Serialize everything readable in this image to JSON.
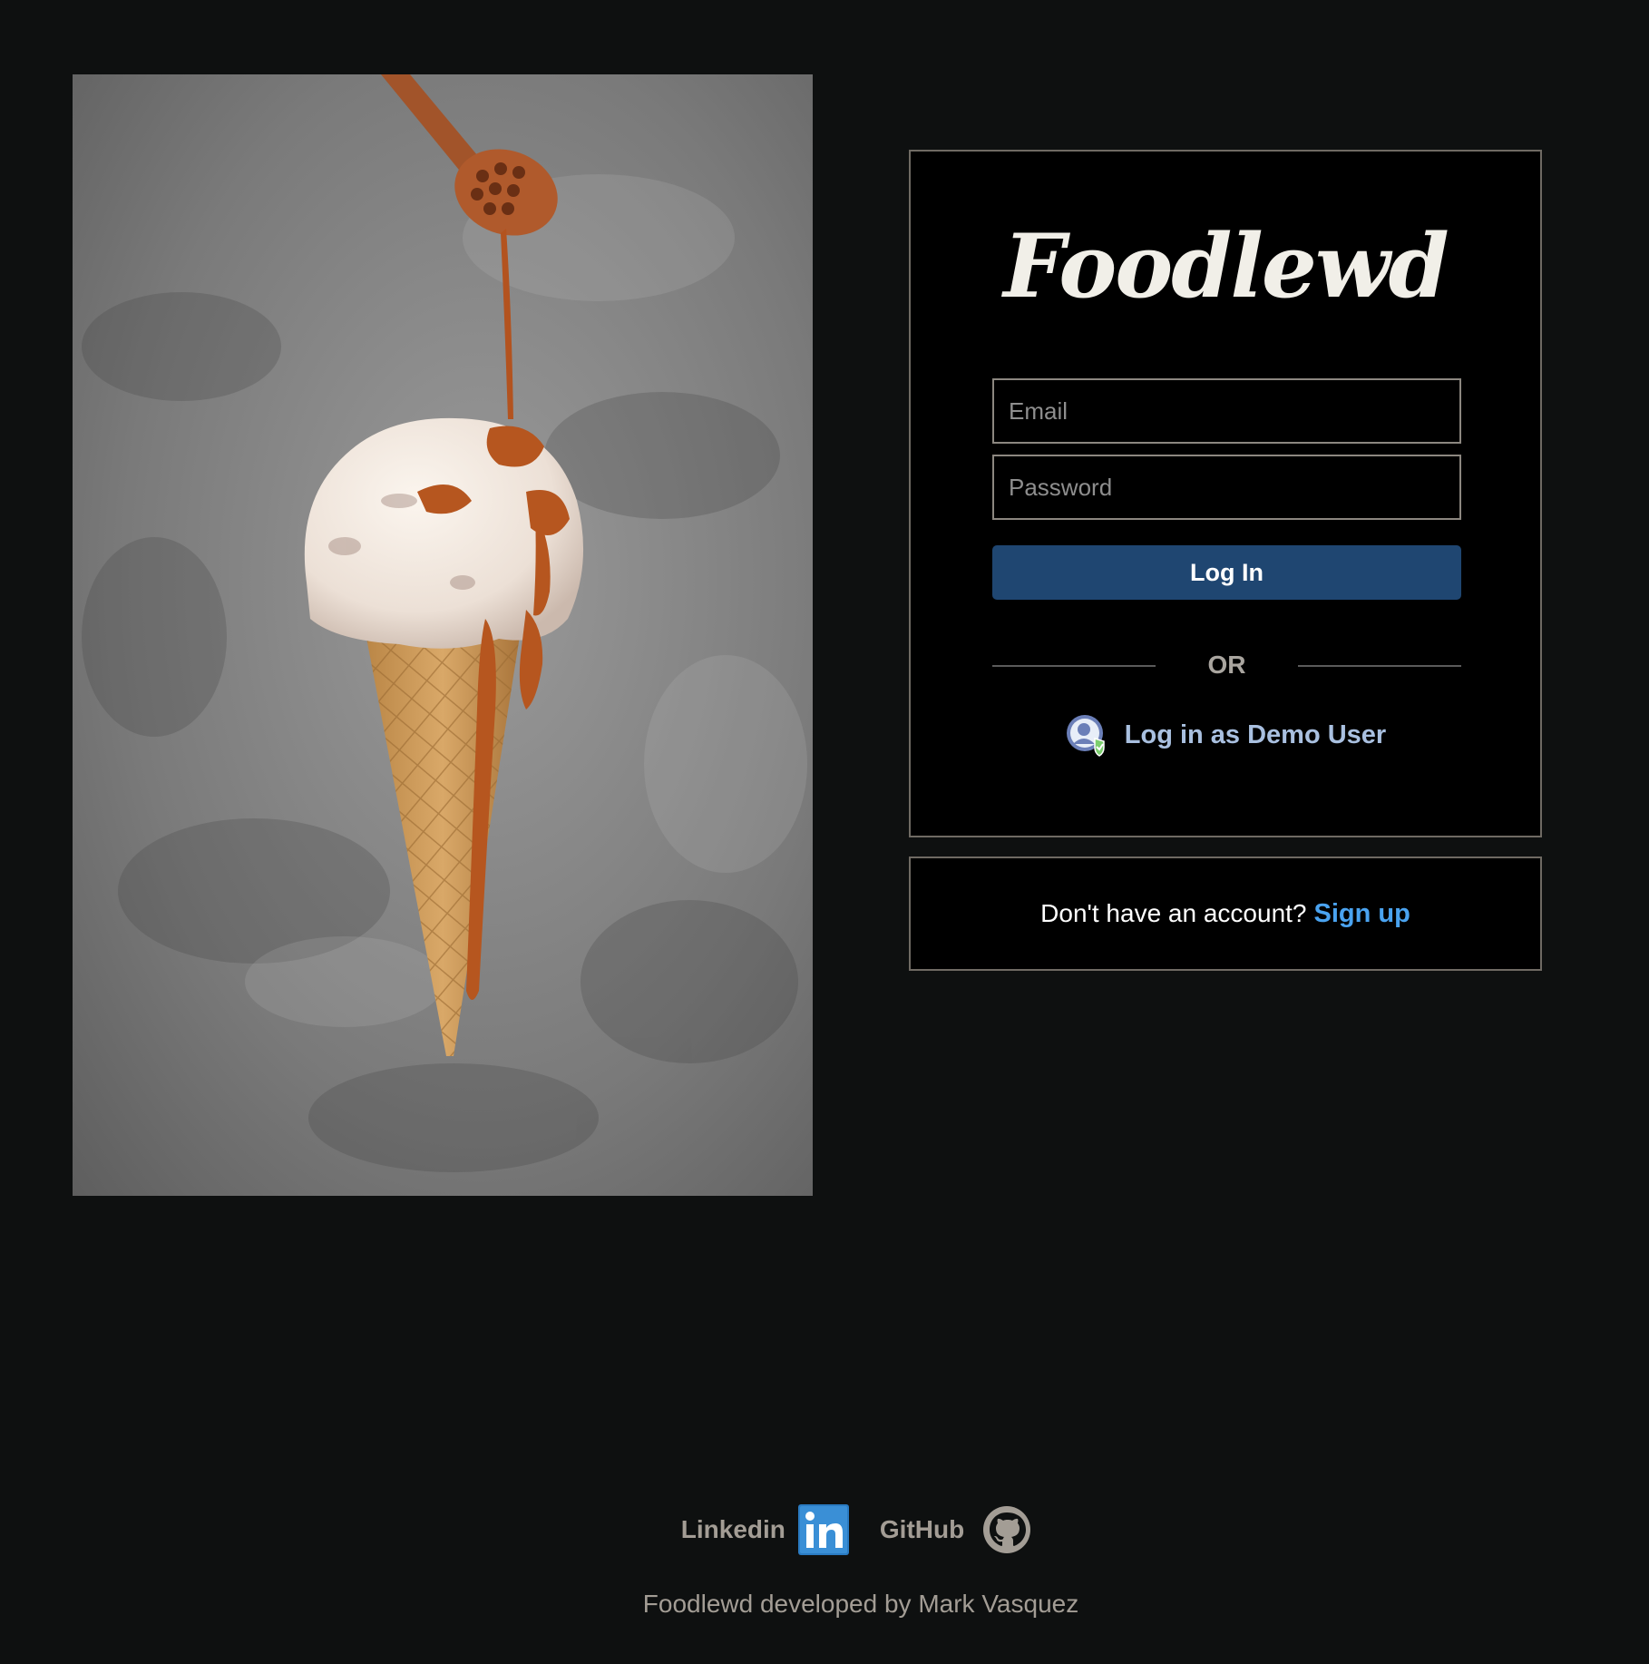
{
  "app": {
    "logo_text": "Foodlewd"
  },
  "login": {
    "email_placeholder": "Email",
    "password_placeholder": "Password",
    "login_button_label": "Log In",
    "divider_text": "OR",
    "demo_label": "Log in as Demo User"
  },
  "signup": {
    "prompt": "Don't have an account?",
    "link_label": "Sign up"
  },
  "footer": {
    "linkedin_label": "Linkedin",
    "github_label": "GitHub",
    "credit": "Foodlewd developed by Mark Vasquez"
  },
  "colors": {
    "background": "#0e1010",
    "card_border": "#6f6a63",
    "login_button": "#1f4671",
    "demo_link": "#a9c0e0",
    "signup_link": "#4aa3f0",
    "footer_text": "#a39d95"
  },
  "icons": {
    "demo_user": "user-shield-icon",
    "linkedin": "linkedin-icon",
    "github": "github-icon"
  },
  "hero": {
    "subject": "ice cream cone with caramel drizzle"
  }
}
